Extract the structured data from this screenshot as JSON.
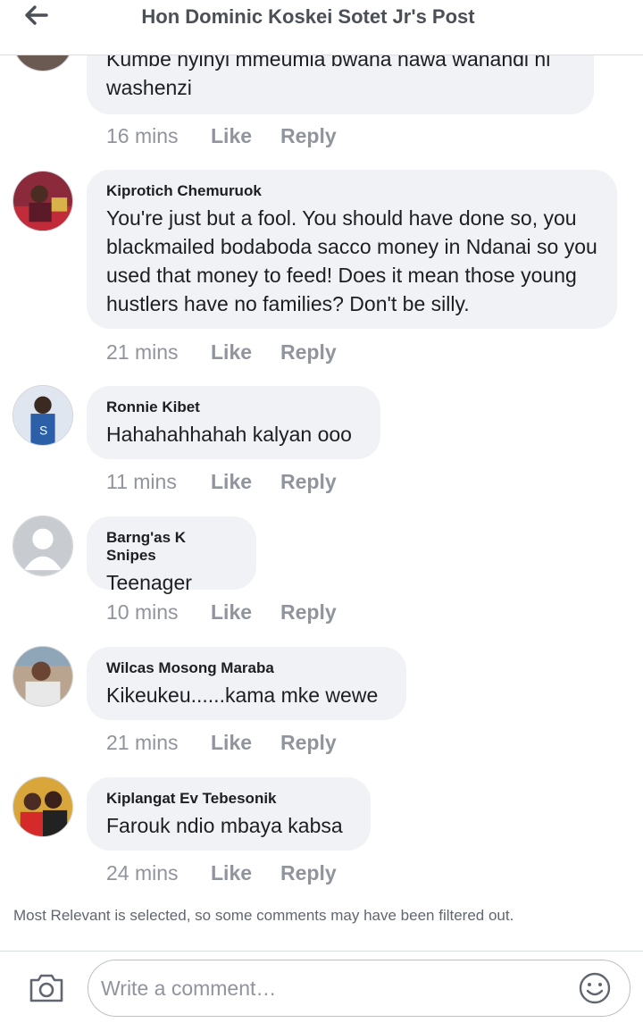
{
  "header": {
    "title": "Hon Dominic Koskei Sotet Jr's Post"
  },
  "comments": [
    {
      "author": "",
      "text": "Kumbe nyinyi mmeumia bwana nawa  wanandi ni washenzi",
      "time": "16 mins",
      "like": "Like",
      "reply": "Reply"
    },
    {
      "author": "Kiprotich Chemuruok",
      "text": "You're just but a fool. You should have done so, you blackmailed bodaboda sacco money in Ndanai so you used that money to feed! Does it mean those young hustlers have no families? Don't be silly.",
      "time": "21 mins",
      "like": "Like",
      "reply": "Reply"
    },
    {
      "author": "Ronnie Kibet",
      "text": "Hahahahhahah kalyan ooo",
      "time": "11 mins",
      "like": "Like",
      "reply": "Reply"
    },
    {
      "author": "Barng'as K Snipes",
      "text": "Teenager",
      "time": "10 mins",
      "like": "Like",
      "reply": "Reply"
    },
    {
      "author": "Wilcas Mosong Maraba",
      "text": "Kikeukeu......kama mke wewe",
      "time": "21 mins",
      "like": "Like",
      "reply": "Reply"
    },
    {
      "author": "Kiplangat Ev Tebesonik",
      "text": "Farouk ndio mbaya kabsa",
      "time": "24 mins",
      "like": "Like",
      "reply": "Reply"
    }
  ],
  "filter_note": "Most Relevant is selected, so some comments may have been filtered out.",
  "composer": {
    "placeholder": "Write a comment…"
  },
  "icons": {
    "back": "back-arrow-icon",
    "camera": "camera-icon",
    "emoji": "emoji-icon"
  }
}
